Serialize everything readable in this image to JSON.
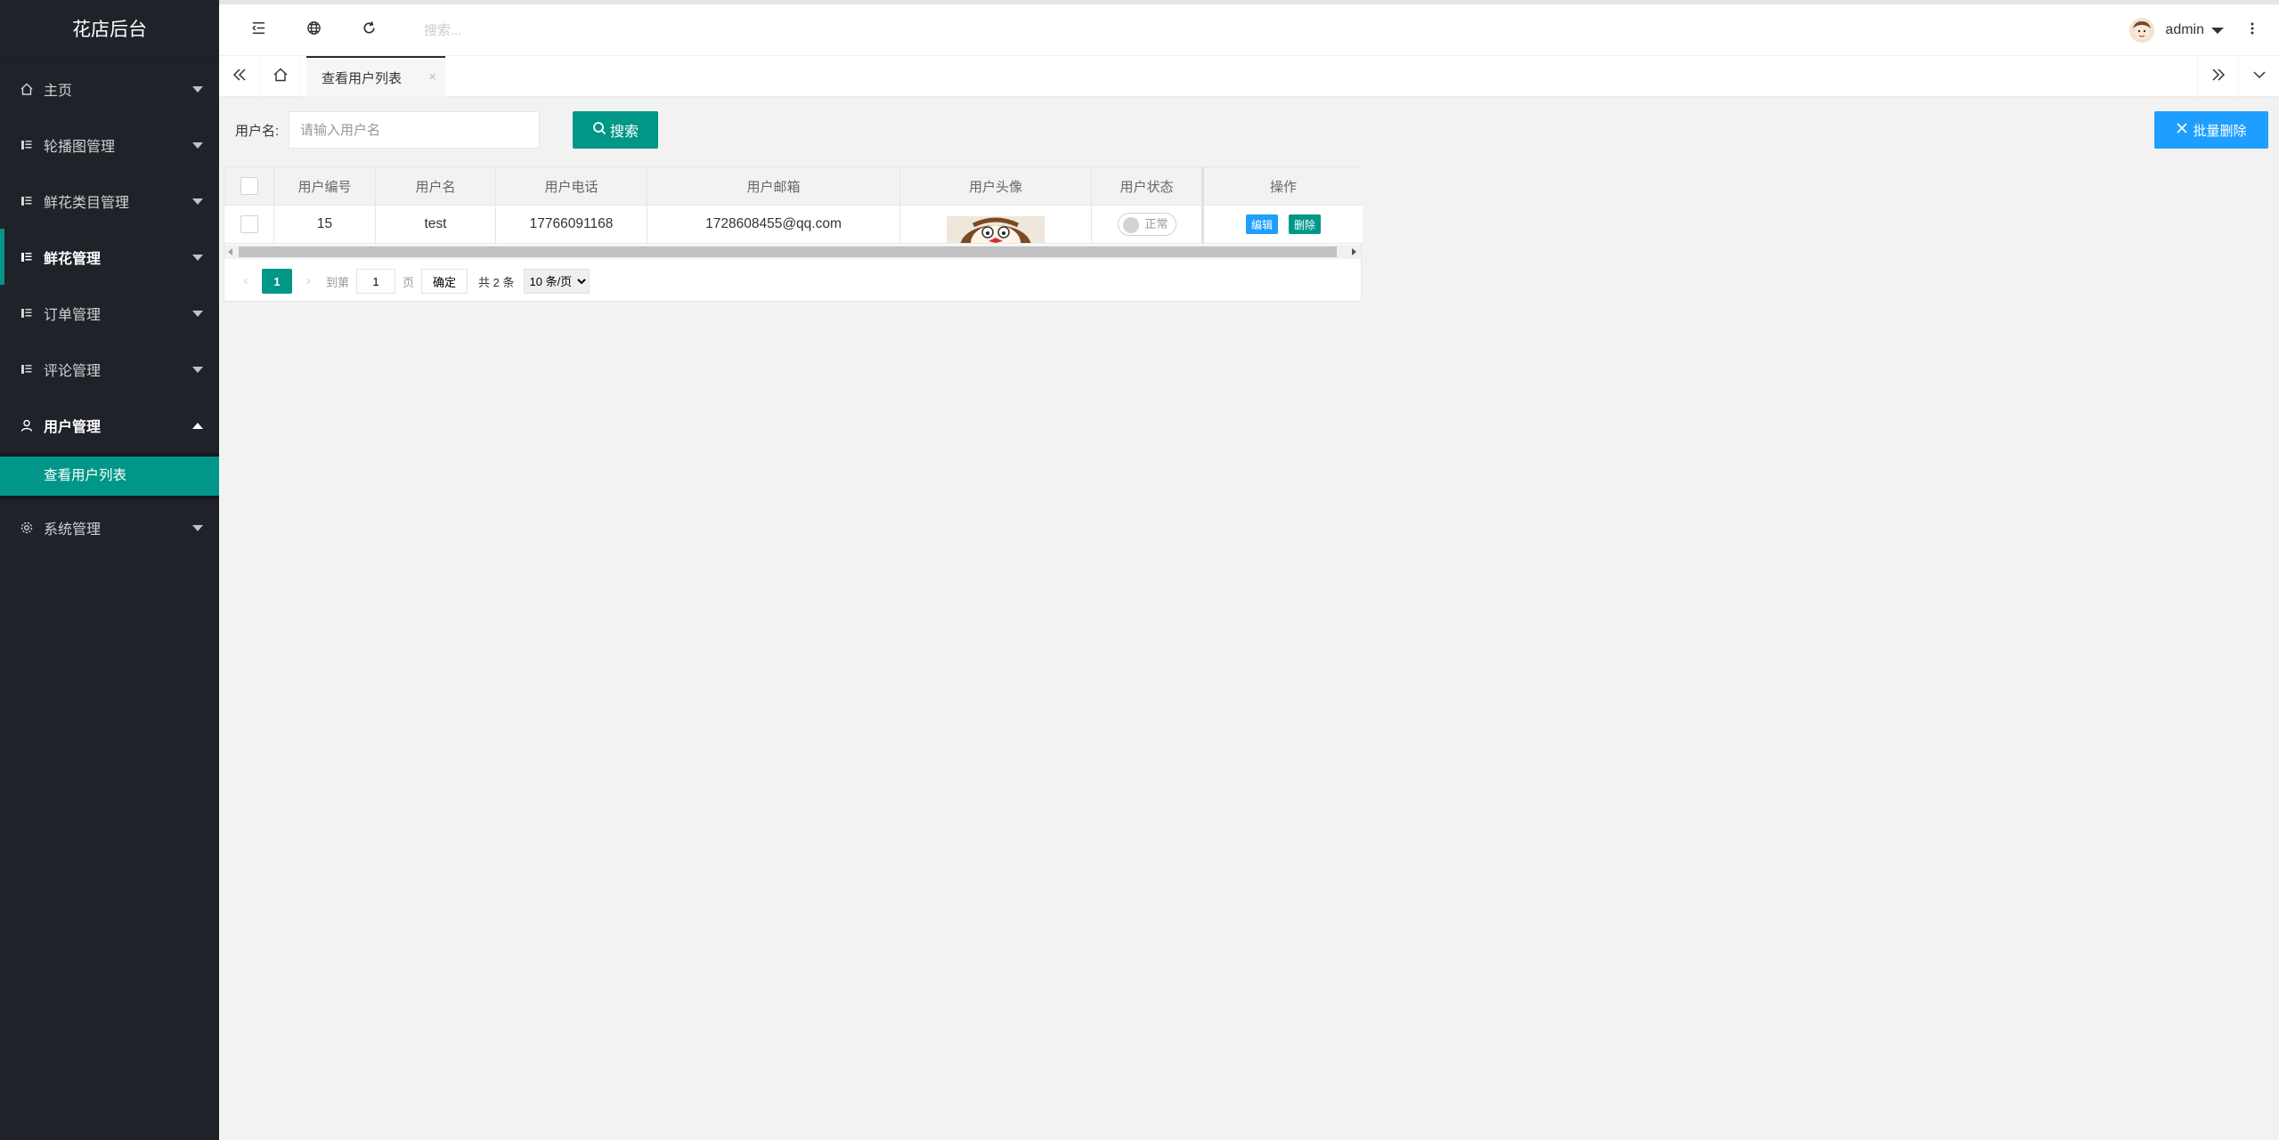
{
  "sidebar": {
    "logo": "花店后台",
    "items": [
      {
        "label": "主页",
        "icon": "home-icon"
      },
      {
        "label": "轮播图管理",
        "icon": "list-icon"
      },
      {
        "label": "鲜花类目管理",
        "icon": "list-icon"
      },
      {
        "label": "鲜花管理",
        "icon": "list-icon"
      },
      {
        "label": "订单管理",
        "icon": "list-icon"
      },
      {
        "label": "评论管理",
        "icon": "list-icon"
      },
      {
        "label": "用户管理",
        "icon": "user-icon"
      },
      {
        "label": "系统管理",
        "icon": "gear-icon"
      }
    ],
    "sub_items": [
      {
        "label": "查看用户列表"
      }
    ]
  },
  "header": {
    "search_placeholder": "搜索...",
    "user_name": "admin"
  },
  "tabs": [
    {
      "label": "查看用户列表",
      "close": "×"
    }
  ],
  "search": {
    "label": "用户名:",
    "placeholder": "请输入用户名",
    "button_label": "搜索"
  },
  "batch_delete_label": "批量删除",
  "table": {
    "columns": [
      "用户编号",
      "用户名",
      "用户电话",
      "用户邮箱",
      "用户头像",
      "用户状态",
      "操作"
    ],
    "rows": [
      {
        "id": "15",
        "name": "test",
        "phone": "17766091168",
        "email": "1728608455@qq.com",
        "status": "正常",
        "edit": "编辑",
        "delete": "删除"
      }
    ]
  },
  "pagination": {
    "current": "1",
    "goto_label": "到第",
    "goto_value": "1",
    "page_label": "页",
    "confirm": "确定",
    "total": "共 2 条",
    "page_size": "10 条/页"
  },
  "colors": {
    "primary": "#009688",
    "blue": "#1e9fff",
    "sidebar": "#20222a"
  }
}
